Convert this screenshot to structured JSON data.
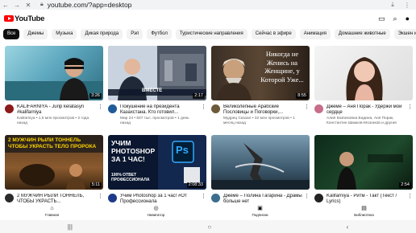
{
  "browser": {
    "url": "youtube.com/?app=desktop",
    "download_icon": "download-icon",
    "menu_icon": "more-vert-icon"
  },
  "header": {
    "logo_text": "YouTube",
    "icons": [
      "search-icon",
      "mic-icon",
      "notifications-icon",
      "account-icon"
    ]
  },
  "chips": [
    "Все",
    "Джемы",
    "Музыка",
    "Дикая природа",
    "Рэп",
    "Футбол",
    "Туристические направления",
    "Сейчас в эфире",
    "Анимация",
    "Домашние животные",
    "Экшен и приключения"
  ],
  "videos": [
    {
      "title": "KALIFARNIYA - Jurip kelatasyn #kalifarniya",
      "sub": "Kalifarniya • 1,5 млн просмотров • 2 года назад",
      "duration": "3:26",
      "avatar_color": "#8b1a1a",
      "thumb_text": ""
    },
    {
      "title": "Покушение на президента Казахстана. Кто готовил...",
      "sub": "Мир 24 • 837 тыс. просмотров • 1 день назад",
      "duration": "2:17",
      "avatar_color": "#1f5c99",
      "thumb_text": "ВМЕСТЕ"
    },
    {
      "title": "Великолепные Арабские Пословицы и Поговорки,...",
      "sub": "Мудрец Сказал • 32 млн просмотров • 1 месяц назад",
      "duration": "8:55",
      "avatar_color": "#6d5a3a",
      "thumb_text": "Никогда не Женись на Женщине, у Которой Уже..."
    },
    {
      "title": "Джеме – Аня Порак - Удержи мои сердце",
      "sub": "Алия Казбековна Бадина, Аня Порак, Константин Шмаков-Мозгиков и другие",
      "duration": "",
      "avatar_color": "#c86e8a",
      "thumb_text": ""
    },
    {
      "title": "2 МУЖЧИН РЫЛИ ТОННЕЛЬ, ЧТОБЫ УКРАСТЬ...",
      "sub": "",
      "duration": "5:11",
      "avatar_color": "#2b2b2b",
      "thumb_text": "2 МУЖЧИН РЫЛИ ТОННЕЛЬ ЧТОБЫ УКРАСТЬ ТЕЛО ПРОРОКА"
    },
    {
      "title": "Учим Photoshop за 1 час! #От Профессионала",
      "sub": "",
      "duration": "2:08:33",
      "avatar_color": "#1e3a8a",
      "thumb_text": "УЧИМ PHOTOSHOP ЗА 1 ЧАС!"
    },
    {
      "title": "Джеме – Полина Гагарина - Драмы больше нет",
      "sub": "",
      "duration": "",
      "avatar_color": "#3b6d8f",
      "thumb_text": ""
    },
    {
      "title": "Kalifarniya - Ритм - Такт (Текст / Lyrics)",
      "sub": "",
      "duration": "2:54",
      "avatar_color": "#222222",
      "thumb_text": ""
    }
  ],
  "ps_badge": "100% ОТВЕТ ПРОФЕССИОНАЛА",
  "ps_logo": "Ps",
  "bottom_nav": [
    {
      "label": "Главная",
      "icon": "home-icon",
      "glyph": "⌂"
    },
    {
      "label": "Навигатор",
      "icon": "explore-icon",
      "glyph": "◎"
    },
    {
      "label": "Подписки",
      "icon": "subscriptions-icon",
      "glyph": "▣"
    },
    {
      "label": "Библиотека",
      "icon": "library-icon",
      "glyph": "▤"
    }
  ],
  "android_nav": [
    "recents-icon",
    "home-circle-icon",
    "back-icon"
  ],
  "colors": {
    "brand_red": "#ff0000",
    "chip_bg": "#f2f2f2",
    "text_secondary": "#606060"
  }
}
